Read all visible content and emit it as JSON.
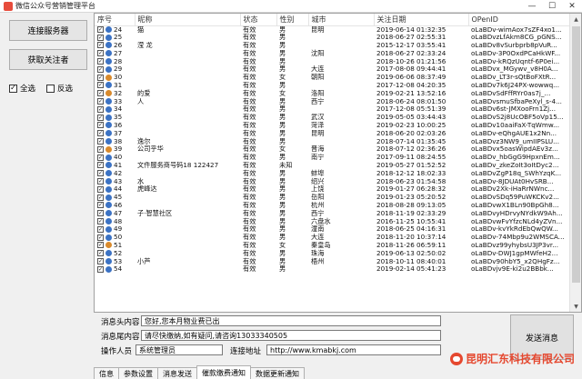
{
  "window": {
    "title": "微信公众号营销管理平台"
  },
  "left": {
    "connect_label": "连接服务器",
    "fetch_label": "获取关注者",
    "select_all_label": "全选",
    "invert_label": "反选"
  },
  "table": {
    "columns": [
      "序号",
      "昵称",
      "状态",
      "性别",
      "城市",
      "关注日期",
      "OPenID"
    ],
    "rows": [
      [
        "24",
        "猫",
        "有效",
        "男",
        "昆明",
        "2019-06-14 01:32:35",
        "oLaBDv-wimAox7sZF4xo1..."
      ],
      [
        "25",
        "",
        "有效",
        "男",
        "",
        "2018-06-27 02:55:31",
        "oLaBDvzLfAkm8CG_pGNS..."
      ],
      [
        "26",
        "滢 龙",
        "有效",
        "男",
        "",
        "2015-12-17 03:55:41",
        "oLaBDv8vSurbprb8pVuR..."
      ],
      [
        "27",
        "",
        "有效",
        "男",
        "沈阳",
        "2018-06-27 02:33:24",
        "oLaBDv-3P0OxdPCaHkWF..."
      ],
      [
        "28",
        "",
        "有效",
        "男",
        "",
        "2018-10-26 01:21:56",
        "oLaBDv-kRQzUqntf-6P0ei..."
      ],
      [
        "29",
        "",
        "有效",
        "男",
        "大连",
        "2017-08-08 09:44:41",
        "oLaBDvx_MGywv_v8H0A..."
      ],
      [
        "30",
        "",
        "有效",
        "女",
        "朝阳",
        "2019-06-06 08:37:49",
        "oLaBDv_LT3r-sQtBoFXtR..."
      ],
      [
        "31",
        "",
        "有效",
        "男",
        "",
        "2017-12-08 04:20:35",
        "oLaBDv7k6J24PX-wowwq..."
      ],
      [
        "32",
        "的爱",
        "有效",
        "女",
        "洛阳",
        "2019-02-21 13:52:16",
        "oLaBDvSdFffRYr0as7j_..."
      ],
      [
        "33",
        "人",
        "有效",
        "男",
        "西宁",
        "2018-06-24 08:01:50",
        "oLaBDvsmuSfbaPeXyl_s-4..."
      ],
      [
        "34",
        "",
        "有效",
        "男",
        "",
        "2017-12-08 05:51:39",
        "oLaBDv6st-JMXooFrn1Zj..."
      ],
      [
        "35",
        "",
        "有效",
        "男",
        "武汉",
        "2019-05-05 03:44:43",
        "oLaBDvS2j8UcOBF5oVp15..."
      ],
      [
        "36",
        "",
        "有效",
        "男",
        "菏泽",
        "2019-02-23 10:00:25",
        "oLaBDv10aaiFaX-TqWmw..."
      ],
      [
        "37",
        "",
        "有效",
        "男",
        "昆明",
        "2018-06-20 02:03:26",
        "oLaBDv-eQhgAUE1x2Nn..."
      ],
      [
        "38",
        "逸尔",
        "有效",
        "男",
        "",
        "2018-07-14 01:35:45",
        "oLaBDvz3NW9_umIIPSLU..."
      ],
      [
        "39",
        "公司乎华",
        "有效",
        "女",
        "晋海",
        "2018-07-12 02:36:26",
        "oLaBDvx5oasWipdAEv3z..."
      ],
      [
        "40",
        "",
        "有效",
        "男",
        "南宁",
        "2017-09-11 08:24:55",
        "oLaBDv_hbGgG9HpxnEm..."
      ],
      [
        "41",
        "文件服务商号码18 122427",
        "有效",
        "未知",
        "",
        "2019-05-27 01:52:52",
        "oLaBDv_zkeZoIt3oItDyc2..."
      ],
      [
        "42",
        "",
        "有效",
        "男",
        "蚌埠",
        "2018-12-12 18:02:33",
        "oLaBDvZgP18q_SWhYzqK..."
      ],
      [
        "43",
        "水",
        "有效",
        "男",
        "绍兴",
        "2018-06-23 01:54:58",
        "oLaBDv-8JDUAt0HvSRB..."
      ],
      [
        "44",
        "虎峰达",
        "有效",
        "男",
        "上饶",
        "2019-01-27 06:28:32",
        "oLaBDv2Xk-iHaRrNWnc..."
      ],
      [
        "45",
        "",
        "有效",
        "男",
        "岳阳",
        "2019-01-23 05:20:52",
        "oLaBDvSDq59PuWKCKv2..."
      ],
      [
        "46",
        "",
        "有效",
        "男",
        "杭州",
        "2018-08-28 09:13:05",
        "oLaBDvwX1BLn90BpGh8..."
      ],
      [
        "47",
        "子·智慧社区",
        "有效",
        "男",
        "西宁",
        "2018-11-19 02:33:29",
        "oLaBDvyHDrvyNYdkW9Ah..."
      ],
      [
        "48",
        "",
        "有效",
        "男",
        "六盘水",
        "2016-11-25 10:55:41",
        "oLaBDvwFvYfzcNLd4yZVn..."
      ],
      [
        "49",
        "",
        "有效",
        "男",
        "潼南",
        "2018-06-25 04:16:31",
        "oLaBDv-kvYkRdEbQwQW..."
      ],
      [
        "50",
        "",
        "有效",
        "男",
        "大连",
        "2018-11-20 10:37:14",
        "oLaBDv-74Mbp9u2WMSCA..."
      ],
      [
        "51",
        "",
        "有效",
        "女",
        "秦皇岛",
        "2018-11-26 06:59:11",
        "oLaBDvz99yhybsU3JP3vr..."
      ],
      [
        "52",
        "",
        "有效",
        "男",
        "珠海",
        "2019-06-13 02:50:02",
        "oLaBDv-DWJ1gpMWfeH2..."
      ],
      [
        "53",
        "小芦",
        "有效",
        "男",
        "梧州",
        "2018-10-11 08:40:01",
        "oLaBDv90hbY5_x2QHgFz..."
      ],
      [
        "54",
        "",
        "有效",
        "男",
        "",
        "2019-02-14 05:41:23",
        "oLaBDvjv9E-ki2u2BBbk..."
      ]
    ]
  },
  "form": {
    "head_label": "消息头内容",
    "head_value": "您好,您本月物业费已出",
    "tail_label": "消息尾内容",
    "tail_value": "请尽快缴纳,如有疑问,请咨询13033340505",
    "operator_label": "操作人员",
    "operator_value": "系统管理员",
    "link_label": "连接地址",
    "link_value": "http://www.kmabkj.com",
    "send_label": "发送消息"
  },
  "tabs": [
    "信息",
    "参数设置",
    "消息发送",
    "催款缴费通知",
    "数据更新通知"
  ],
  "active_tab_index": 3,
  "watermark": {
    "text": "昆明汇东科技有限公司"
  }
}
